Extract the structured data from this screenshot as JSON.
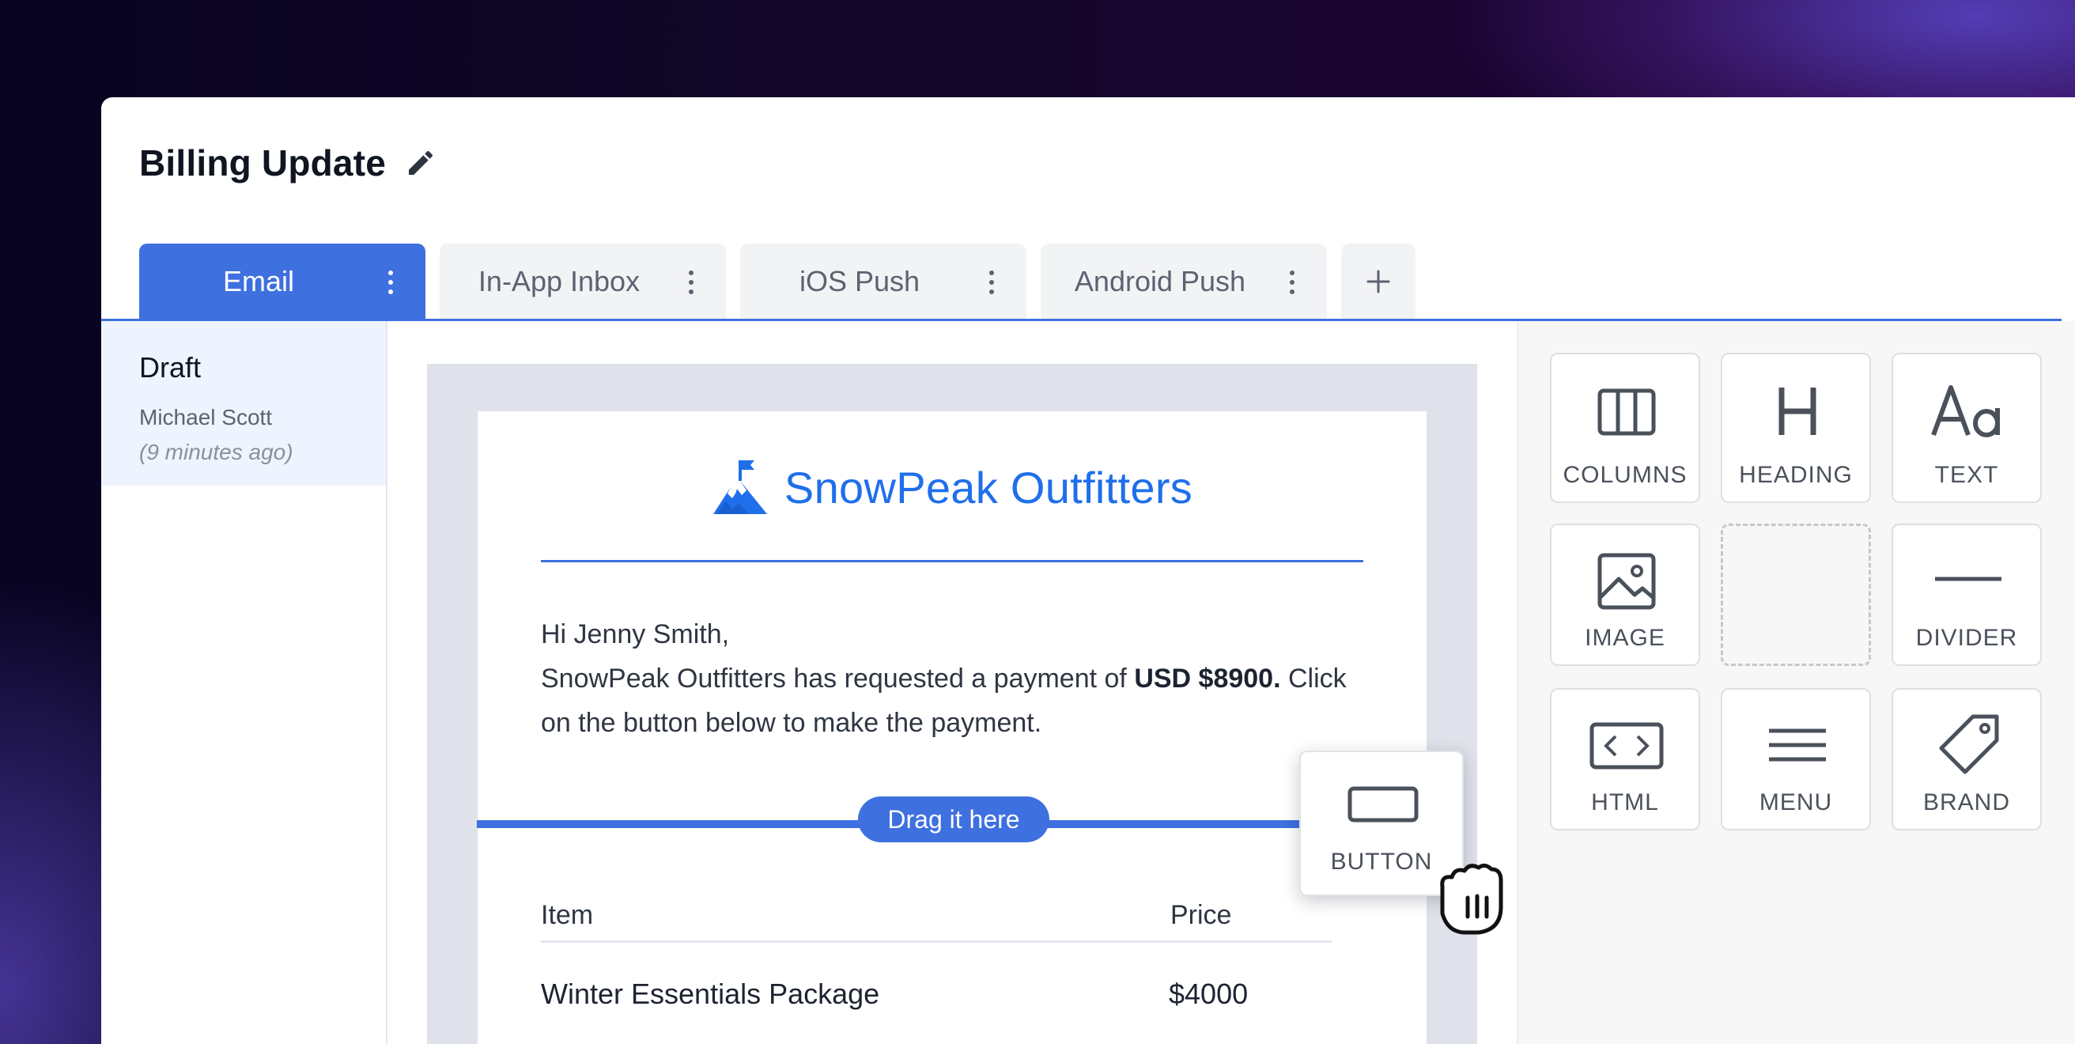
{
  "page": {
    "title": "Billing Update"
  },
  "tabs": [
    {
      "label": "Email",
      "active": true
    },
    {
      "label": "In-App Inbox",
      "active": false
    },
    {
      "label": "iOS Push",
      "active": false
    },
    {
      "label": "Android Push",
      "active": false
    }
  ],
  "add_tab_label": "+",
  "draft": {
    "title": "Draft",
    "author": "Michael Scott",
    "time": "(9 minutes ago)"
  },
  "email": {
    "brand_name": "SnowPeak Outfitters",
    "greeting": "Hi Jenny Smith,",
    "body_prefix": "SnowPeak Outfitters has requested a payment of ",
    "amount": "USD $8900.",
    "body_suffix": " Click on the button below to make the payment.",
    "table": {
      "headers": [
        "Item",
        "Price"
      ],
      "rows": [
        {
          "item": "Winter Essentials Package",
          "price": "$4000"
        }
      ]
    }
  },
  "drop_zone": {
    "label": "Drag it here"
  },
  "dragging_block": {
    "label": "BUTTON",
    "icon": "button-block-icon"
  },
  "blocks": [
    {
      "label": "COLUMNS",
      "icon": "columns-icon"
    },
    {
      "label": "HEADING",
      "icon": "heading-icon"
    },
    {
      "label": "TEXT",
      "icon": "text-icon"
    },
    {
      "label": "IMAGE",
      "icon": "image-icon"
    },
    {
      "label": "",
      "icon": ""
    },
    {
      "label": "DIVIDER",
      "icon": "divider-icon"
    },
    {
      "label": "HTML",
      "icon": "html-icon"
    },
    {
      "label": "MENU",
      "icon": "menu-icon"
    },
    {
      "label": "BRAND",
      "icon": "brand-tag-icon"
    }
  ],
  "colors": {
    "accent": "#3e70df",
    "brand": "#1f6feb"
  }
}
